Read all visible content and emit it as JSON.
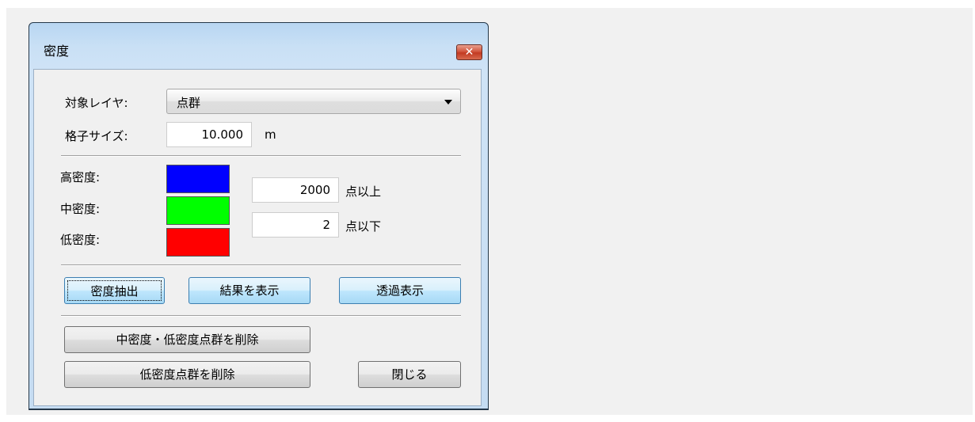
{
  "window": {
    "title": "密度",
    "close_label": "✕"
  },
  "form": {
    "target_layer_label": "対象レイヤ:",
    "target_layer_value": "点群",
    "grid_size_label": "格子サイズ:",
    "grid_size_value": "10.000",
    "grid_size_unit": "m"
  },
  "density": {
    "high_label": "高密度:",
    "mid_label": "中密度:",
    "low_label": "低密度:",
    "high_color": "#0000ff",
    "mid_color": "#00ff00",
    "low_color": "#ff0000",
    "upper_value": "2000",
    "upper_suffix": "点以上",
    "lower_value": "2",
    "lower_suffix": "点以下"
  },
  "actions": {
    "extract_label": "密度抽出",
    "show_result_label": "結果を表示",
    "transparent_label": "透過表示",
    "delete_mid_low_label": "中密度・低密度点群を削除",
    "delete_low_label": "低密度点群を削除",
    "close_label": "閉じる"
  }
}
